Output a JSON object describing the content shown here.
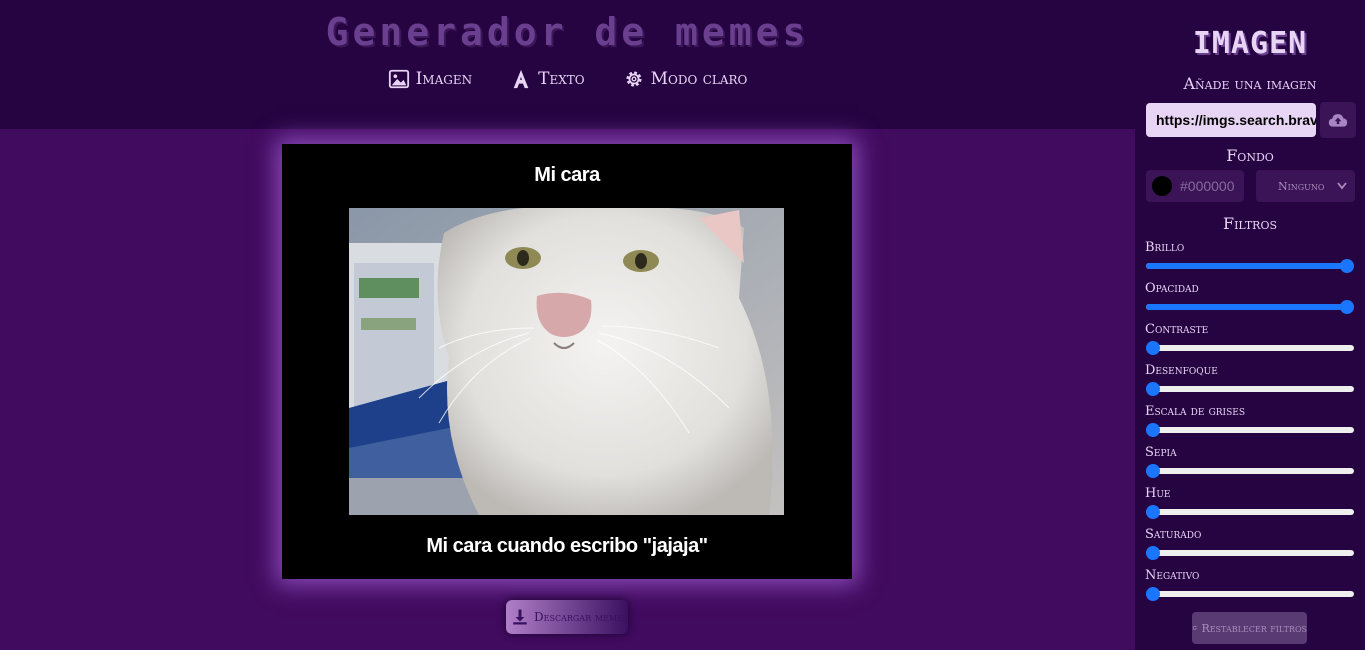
{
  "app": {
    "title": "Generador de memes"
  },
  "nav": {
    "items": [
      {
        "label": "Imagen",
        "icon": "image-icon"
      },
      {
        "label": "Texto",
        "icon": "text-icon"
      },
      {
        "label": "Modo claro",
        "icon": "gear-icon"
      }
    ]
  },
  "meme": {
    "top_text": "Mi cara",
    "bottom_text": "Mi cara cuando escribo \"jajaja\"",
    "background_color": "#000000",
    "image_alt": "white cat"
  },
  "download": {
    "label": "Descargar meme",
    "icon": "download-icon"
  },
  "panel": {
    "title": "IMAGEN",
    "add_image_label": "Añade una imagen",
    "url_value": "https://imgs.search.brave",
    "upload_icon": "cloud-upload-icon",
    "background_label": "Fondo",
    "color_value": "#000000",
    "blend_mode": "Ninguno",
    "filters_label": "Filtros",
    "filters": [
      {
        "label": "Brillo",
        "value": 1.0
      },
      {
        "label": "Opacidad",
        "value": 1.0
      },
      {
        "label": "Contraste",
        "value": 0.0
      },
      {
        "label": "Desenfoque",
        "value": 0.0
      },
      {
        "label": "Escala de grises",
        "value": 0.0
      },
      {
        "label": "Sepia",
        "value": 0.0
      },
      {
        "label": "Hue",
        "value": 0.0
      },
      {
        "label": "Saturado",
        "value": 0.0
      },
      {
        "label": "Negativo",
        "value": 0.0
      }
    ],
    "reset_label": "Restablecer filtros",
    "reset_icon": "refresh-icon"
  },
  "colors": {
    "header_bg": "#250441",
    "page_bg": "#410b5f",
    "accent": "#e8d4f5",
    "slider": "#1a75ff"
  }
}
